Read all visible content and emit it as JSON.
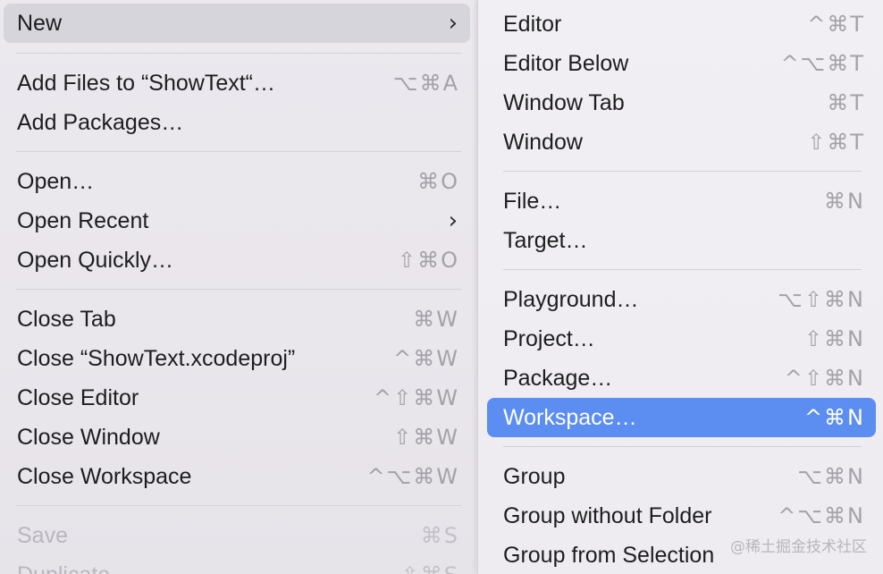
{
  "file_menu": {
    "items": [
      {
        "label": "New",
        "shortcut": "",
        "submenu": true
      },
      {
        "label": "Add Files to “ShowText“…",
        "shortcut": "⌥⌘A"
      },
      {
        "label": "Add Packages…",
        "shortcut": ""
      },
      {
        "label": "Open…",
        "shortcut": "⌘O"
      },
      {
        "label": "Open Recent",
        "shortcut": "",
        "submenu": true
      },
      {
        "label": "Open Quickly…",
        "shortcut": "⇧⌘O"
      },
      {
        "label": "Close Tab",
        "shortcut": "⌘W"
      },
      {
        "label": "Close “ShowText.xcodeproj”",
        "shortcut": "^⌘W"
      },
      {
        "label": "Close Editor",
        "shortcut": "^⇧⌘W"
      },
      {
        "label": "Close Window",
        "shortcut": "⇧⌘W"
      },
      {
        "label": "Close Workspace",
        "shortcut": "^⌥⌘W"
      },
      {
        "label": "Save",
        "shortcut": "⌘S",
        "disabled": true
      },
      {
        "label": "Duplicate",
        "shortcut": "⇧⌘S",
        "disabled": true
      }
    ],
    "chevron_glyph": "›"
  },
  "new_submenu": {
    "items": [
      {
        "label": "Editor",
        "shortcut": "^⌘T"
      },
      {
        "label": "Editor Below",
        "shortcut": "^⌥⌘T"
      },
      {
        "label": "Window Tab",
        "shortcut": "⌘T"
      },
      {
        "label": "Window",
        "shortcut": "⇧⌘T"
      },
      {
        "label": "File…",
        "shortcut": "⌘N"
      },
      {
        "label": "Target…",
        "shortcut": ""
      },
      {
        "label": "Playground…",
        "shortcut": "⌥⇧⌘N"
      },
      {
        "label": "Project…",
        "shortcut": "⇧⌘N"
      },
      {
        "label": "Package…",
        "shortcut": "^⇧⌘N"
      },
      {
        "label": "Workspace…",
        "shortcut": "^⌘N",
        "selected": true
      },
      {
        "label": "Group",
        "shortcut": "⌥⌘N"
      },
      {
        "label": "Group without Folder",
        "shortcut": "^⌥⌘N"
      },
      {
        "label": "Group from Selection",
        "shortcut": ""
      }
    ]
  },
  "watermark": "@稀土掘金技术社区",
  "colors": {
    "selection": "#5b8ef0",
    "hover": "#d7d5dc",
    "text": "#1d1d1f",
    "shortcut": "#a4a1a8"
  }
}
